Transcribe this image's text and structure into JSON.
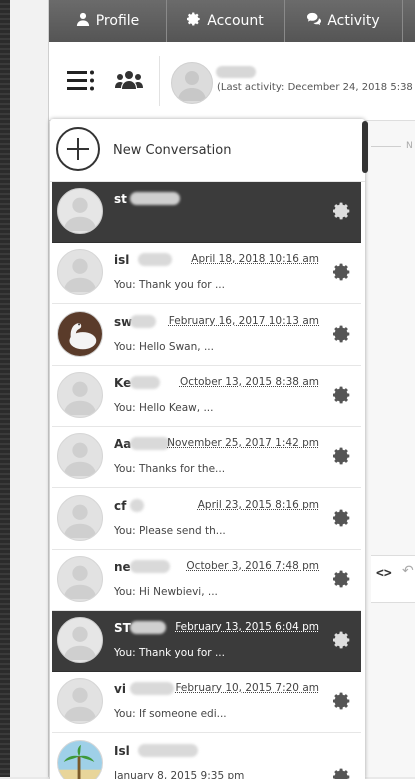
{
  "nav": {
    "tabs": [
      {
        "label": "Profile",
        "icon": "user-icon"
      },
      {
        "label": "Account",
        "icon": "gear-icon"
      },
      {
        "label": "Activity",
        "icon": "chat-bubbles-icon"
      }
    ]
  },
  "header": {
    "last_activity": "(Last activity: December 24, 2018 5:38"
  },
  "chat": {
    "marker": "N"
  },
  "panel": {
    "new_conversation_label": "New Conversation",
    "conversations": [
      {
        "name": "st",
        "date": "",
        "preview": "",
        "selected": true
      },
      {
        "name": "isl",
        "date": "April 18, 2018 10:16 am",
        "preview": "You: Thank you for ...",
        "selected": false
      },
      {
        "name": "sw",
        "date": "February 16, 2017 10:13 am",
        "preview": "You: Hello Swan, ...",
        "selected": false
      },
      {
        "name": "Ke",
        "date": "October 13, 2015 8:38 am",
        "preview": "You: Hello Keaw, ...",
        "selected": false
      },
      {
        "name": "Aa",
        "date": "November 25, 2017 1:42 pm",
        "preview": "You: Thanks for the...",
        "selected": false
      },
      {
        "name": "cf",
        "date": "April 23, 2015 8:16 pm",
        "preview": "You: Please send th...",
        "selected": false
      },
      {
        "name": "ne",
        "date": "October 3, 2016 7:48 pm",
        "preview": "You: Hi Newbievi, ...",
        "selected": false
      },
      {
        "name": "ST",
        "date": "February 13, 2015 6:04 pm",
        "preview": "You: Thank you for ...",
        "selected": true
      },
      {
        "name": "vi",
        "date": "February 10, 2015 7:20 am",
        "preview": "You: If someone edi...",
        "selected": false
      },
      {
        "name": "Isl",
        "date": "January 8, 2015 9:35 pm",
        "preview": "",
        "selected": false
      }
    ]
  }
}
